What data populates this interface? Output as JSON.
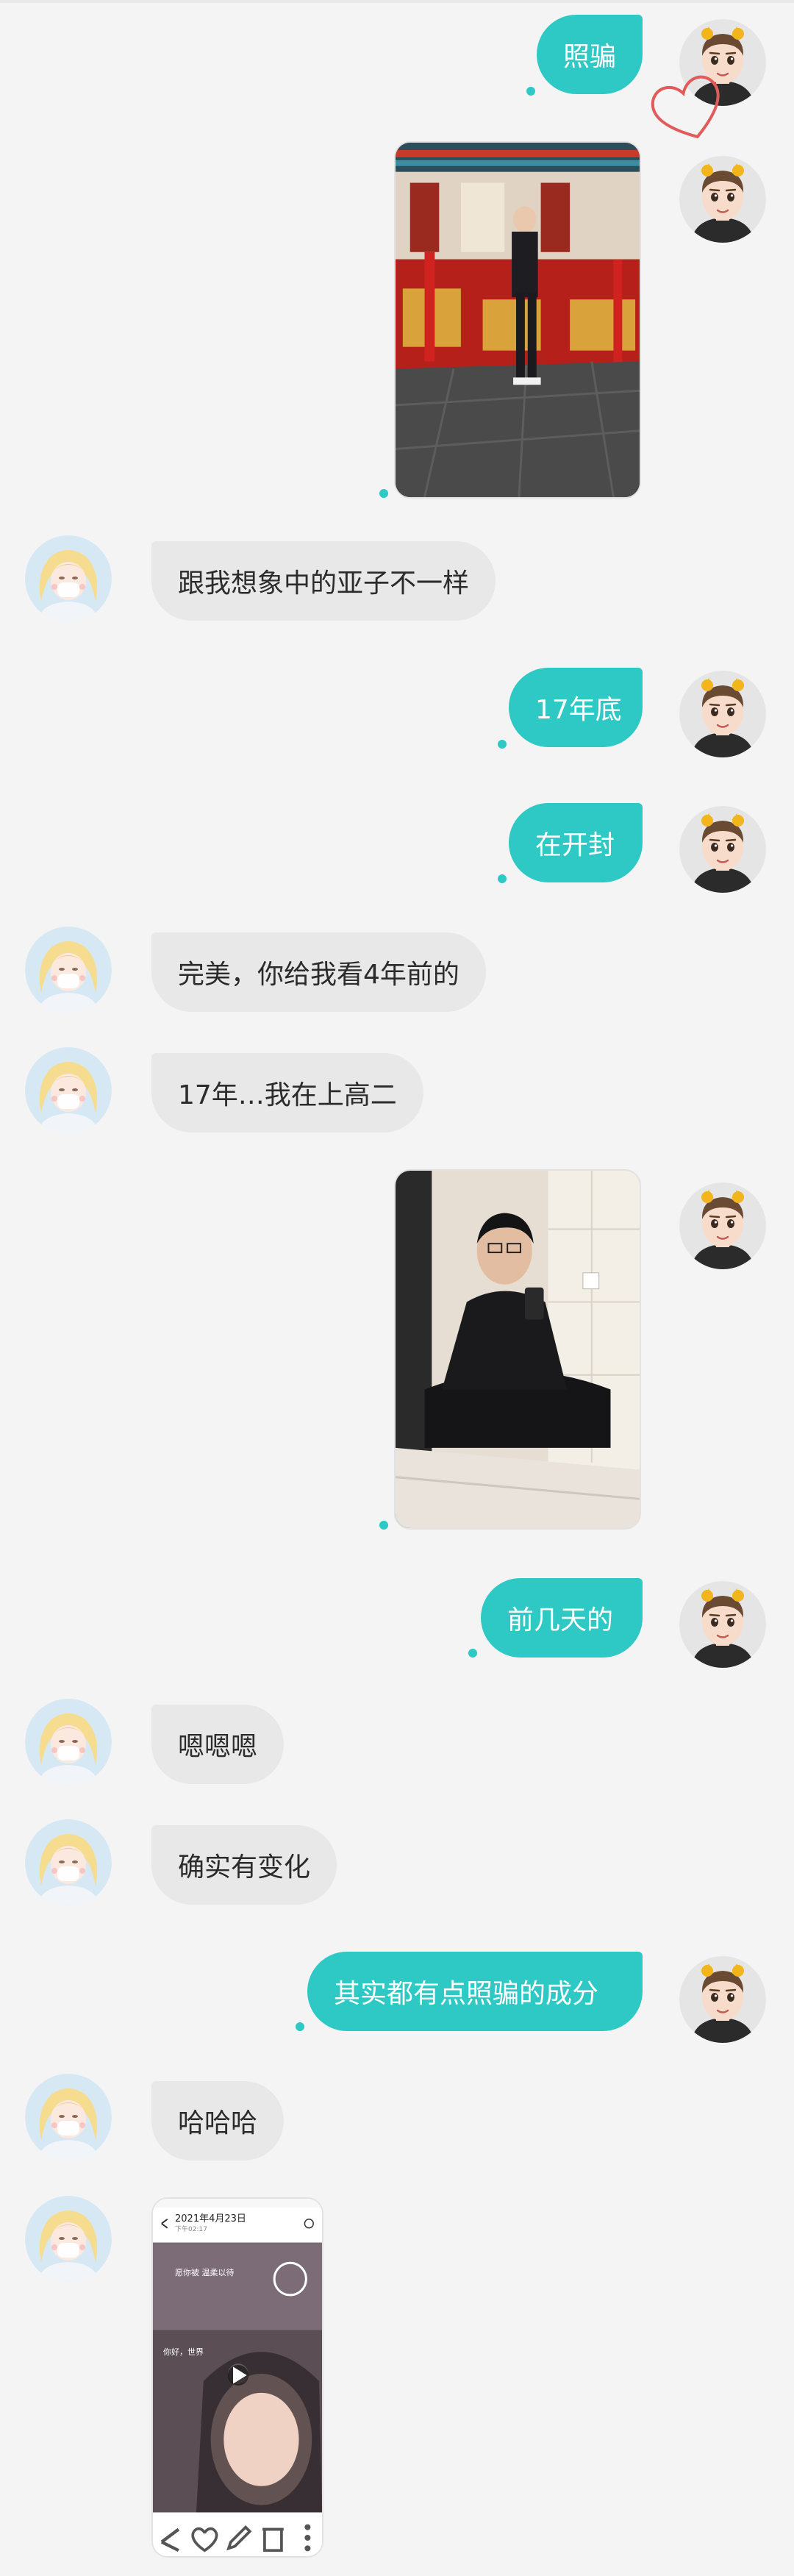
{
  "conversation": {
    "messages": [
      {
        "sender": "me",
        "type": "text",
        "text": "照骗"
      },
      {
        "sender": "me",
        "type": "image",
        "image": "photo-temple-corridor"
      },
      {
        "sender": "friend",
        "type": "text",
        "text": "跟我想象中的亚子不一样"
      },
      {
        "sender": "me",
        "type": "text",
        "text": "17年底"
      },
      {
        "sender": "me",
        "type": "text",
        "text": "在开封"
      },
      {
        "sender": "friend",
        "type": "text",
        "text": "完美，你给我看4年前的"
      },
      {
        "sender": "friend",
        "type": "text",
        "text": "17年…我在上高二"
      },
      {
        "sender": "me",
        "type": "image",
        "image": "photo-mirror-selfie"
      },
      {
        "sender": "me",
        "type": "text",
        "text": "前几天的"
      },
      {
        "sender": "friend",
        "type": "text",
        "text": "嗯嗯嗯"
      },
      {
        "sender": "friend",
        "type": "text",
        "text": "确实有变化"
      },
      {
        "sender": "me",
        "type": "text",
        "text": "其实都有点照骗的成分"
      },
      {
        "sender": "friend",
        "type": "text",
        "text": "哈哈哈"
      },
      {
        "sender": "friend",
        "type": "image",
        "image": "phone-screenshot"
      }
    ]
  },
  "screenshot_thumb": {
    "date": "2021年4月23日",
    "subtitle": "下午02:17",
    "caption1": "愿你被 温柔以待",
    "caption2": "你好，世界"
  },
  "icons": {
    "my_avatar": "cartoon-boy-avatar-icon",
    "friend_avatar": "cartoon-girl-avatar-icon",
    "like": "heart-outline-icon",
    "play": "play-icon"
  },
  "colors": {
    "my_bubble": "#2ec9c4",
    "friend_bubble": "#e8e8e9",
    "background": "#f4f4f5",
    "heart": "#e25b5b"
  }
}
